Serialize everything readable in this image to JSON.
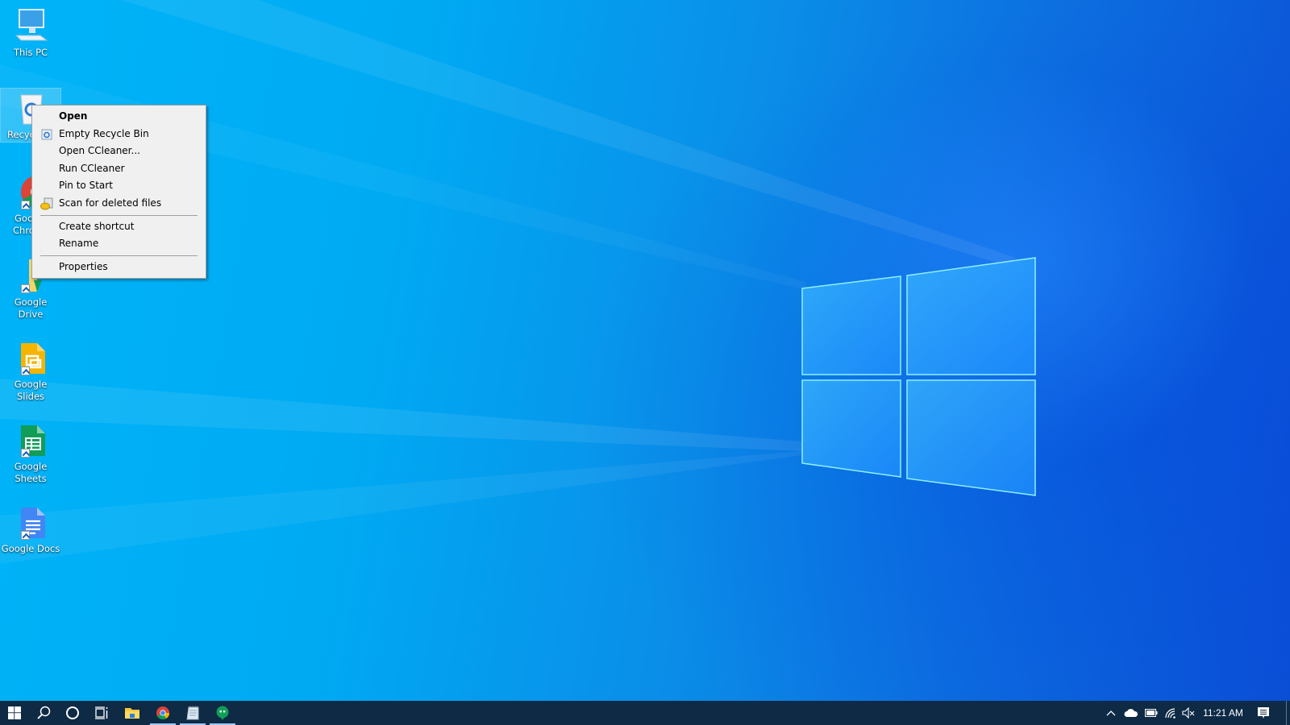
{
  "desktop": {
    "icons": [
      {
        "label": "This PC",
        "icon": "computer-icon"
      },
      {
        "label": "Recycle Bin",
        "icon": "recycle-bin-icon",
        "selected": true,
        "visible_label": "Recyc"
      },
      {
        "label_line1": "Google",
        "label_line2": "Chrome",
        "visible_line1": "Goo",
        "visible_line2": "Chro",
        "icon": "chrome-icon"
      },
      {
        "label": "Google Drive",
        "icon": "folder-icon"
      },
      {
        "label": "Google Slides",
        "icon": "google-slides-icon"
      },
      {
        "label_line1": "Google",
        "label_line2": "Sheets",
        "icon": "google-sheets-icon"
      },
      {
        "label": "Google Docs",
        "icon": "google-docs-icon"
      }
    ]
  },
  "context_menu": {
    "items": [
      {
        "label": "Open",
        "bold": true
      },
      {
        "label": "Empty Recycle Bin",
        "icon": "recycle-icon"
      },
      {
        "label": "Open CCleaner..."
      },
      {
        "label": "Run CCleaner"
      },
      {
        "label": "Pin to Start"
      },
      {
        "label": "Scan for deleted files",
        "icon": "recuva-icon"
      },
      {
        "label": "Create shortcut"
      },
      {
        "label": "Rename"
      },
      {
        "label": "Properties"
      }
    ]
  },
  "taskbar": {
    "start": "windows-start-icon",
    "search": "search-icon",
    "cortana": "cortana-icon",
    "task_view": "task-view-icon",
    "pinned": [
      {
        "name": "File Explorer",
        "icon": "file-explorer-icon",
        "running": false
      },
      {
        "name": "Google Chrome",
        "icon": "chrome-icon",
        "running": true
      },
      {
        "name": "Notepad",
        "icon": "notepad-icon",
        "running": true
      },
      {
        "name": "Hangouts",
        "icon": "hangouts-icon",
        "running": true
      }
    ],
    "tray": {
      "icons": [
        "chevron-up-icon",
        "onedrive-cloud-icon",
        "battery-icon",
        "wifi-icon",
        "volume-muted-icon"
      ],
      "clock": "11:21 AM",
      "notifications": "action-center-icon"
    }
  },
  "colors": {
    "taskbar_bg": "#0e2a45",
    "menu_bg": "#f0f0f0",
    "wallpaper_light": "#00b4f8",
    "wallpaper_dark": "#0b4fd6"
  }
}
